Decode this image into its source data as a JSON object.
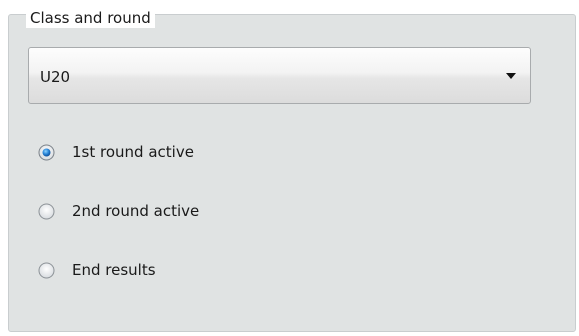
{
  "group": {
    "title": "Class and round"
  },
  "class_select": {
    "value": "U20"
  },
  "rounds": [
    {
      "label": "1st round active",
      "checked": true
    },
    {
      "label": "2nd round active",
      "checked": false
    },
    {
      "label": "End results",
      "checked": false
    }
  ],
  "icons": {
    "dropdown": "chevron-down-icon",
    "radio_selected": "radio-selected-icon",
    "radio_unselected": "radio-unselected-icon"
  }
}
